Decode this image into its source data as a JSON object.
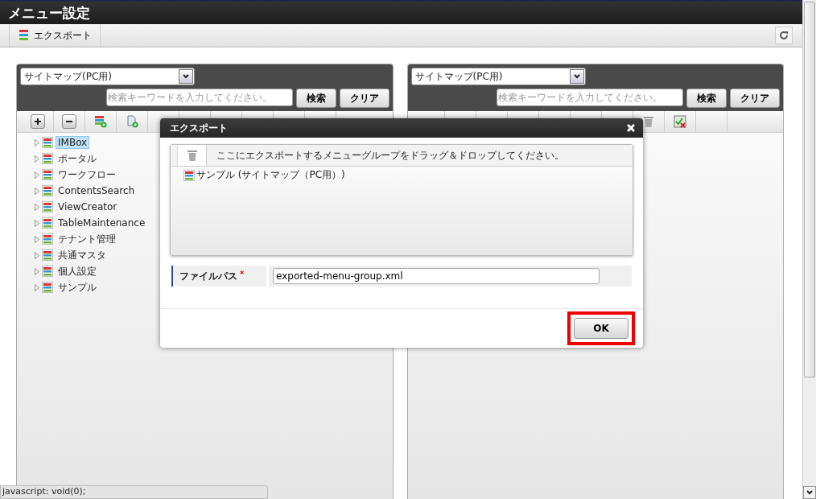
{
  "page_title": "メニュー設定",
  "toolbar": {
    "export_button": "エクスポート"
  },
  "panels": [
    {
      "site_select": "サイトマップ(PC用)",
      "search": {
        "placeholder": "検索キーワードを入力してください。"
      },
      "buttons": [
        "検索",
        "クリア"
      ],
      "tree": [
        {
          "label": "IMBox",
          "selected": true
        },
        {
          "label": "ポータル",
          "selected": false
        },
        {
          "label": "ワークフロー",
          "selected": false
        },
        {
          "label": "ContentsSearch",
          "selected": false
        },
        {
          "label": "ViewCreator",
          "selected": false
        },
        {
          "label": "TableMaintenance",
          "selected": false
        },
        {
          "label": "テナント管理",
          "selected": false
        },
        {
          "label": "共通マスタ",
          "selected": false
        },
        {
          "label": "個人設定",
          "selected": false
        },
        {
          "label": "サンプル",
          "selected": false
        }
      ]
    },
    {
      "site_select": "サイトマップ(PC用)",
      "search": {
        "placeholder": "検索キーワードを入力してください。"
      },
      "buttons": [
        "検索",
        "クリア"
      ]
    }
  ],
  "dialog": {
    "title": "エクスポート",
    "drop_hint": "ここにエクスポートするメニューグループをドラッグ＆ドロップしてください。",
    "items": [
      "サンプル (サイトマップ（PC用）)"
    ],
    "field": {
      "label": "ファイルパス",
      "required_mark": "*",
      "value": "exported-menu-group.xml"
    },
    "ok_button": "OK",
    "ok_highlighted": true
  },
  "status_text": "javascript: void(0);"
}
